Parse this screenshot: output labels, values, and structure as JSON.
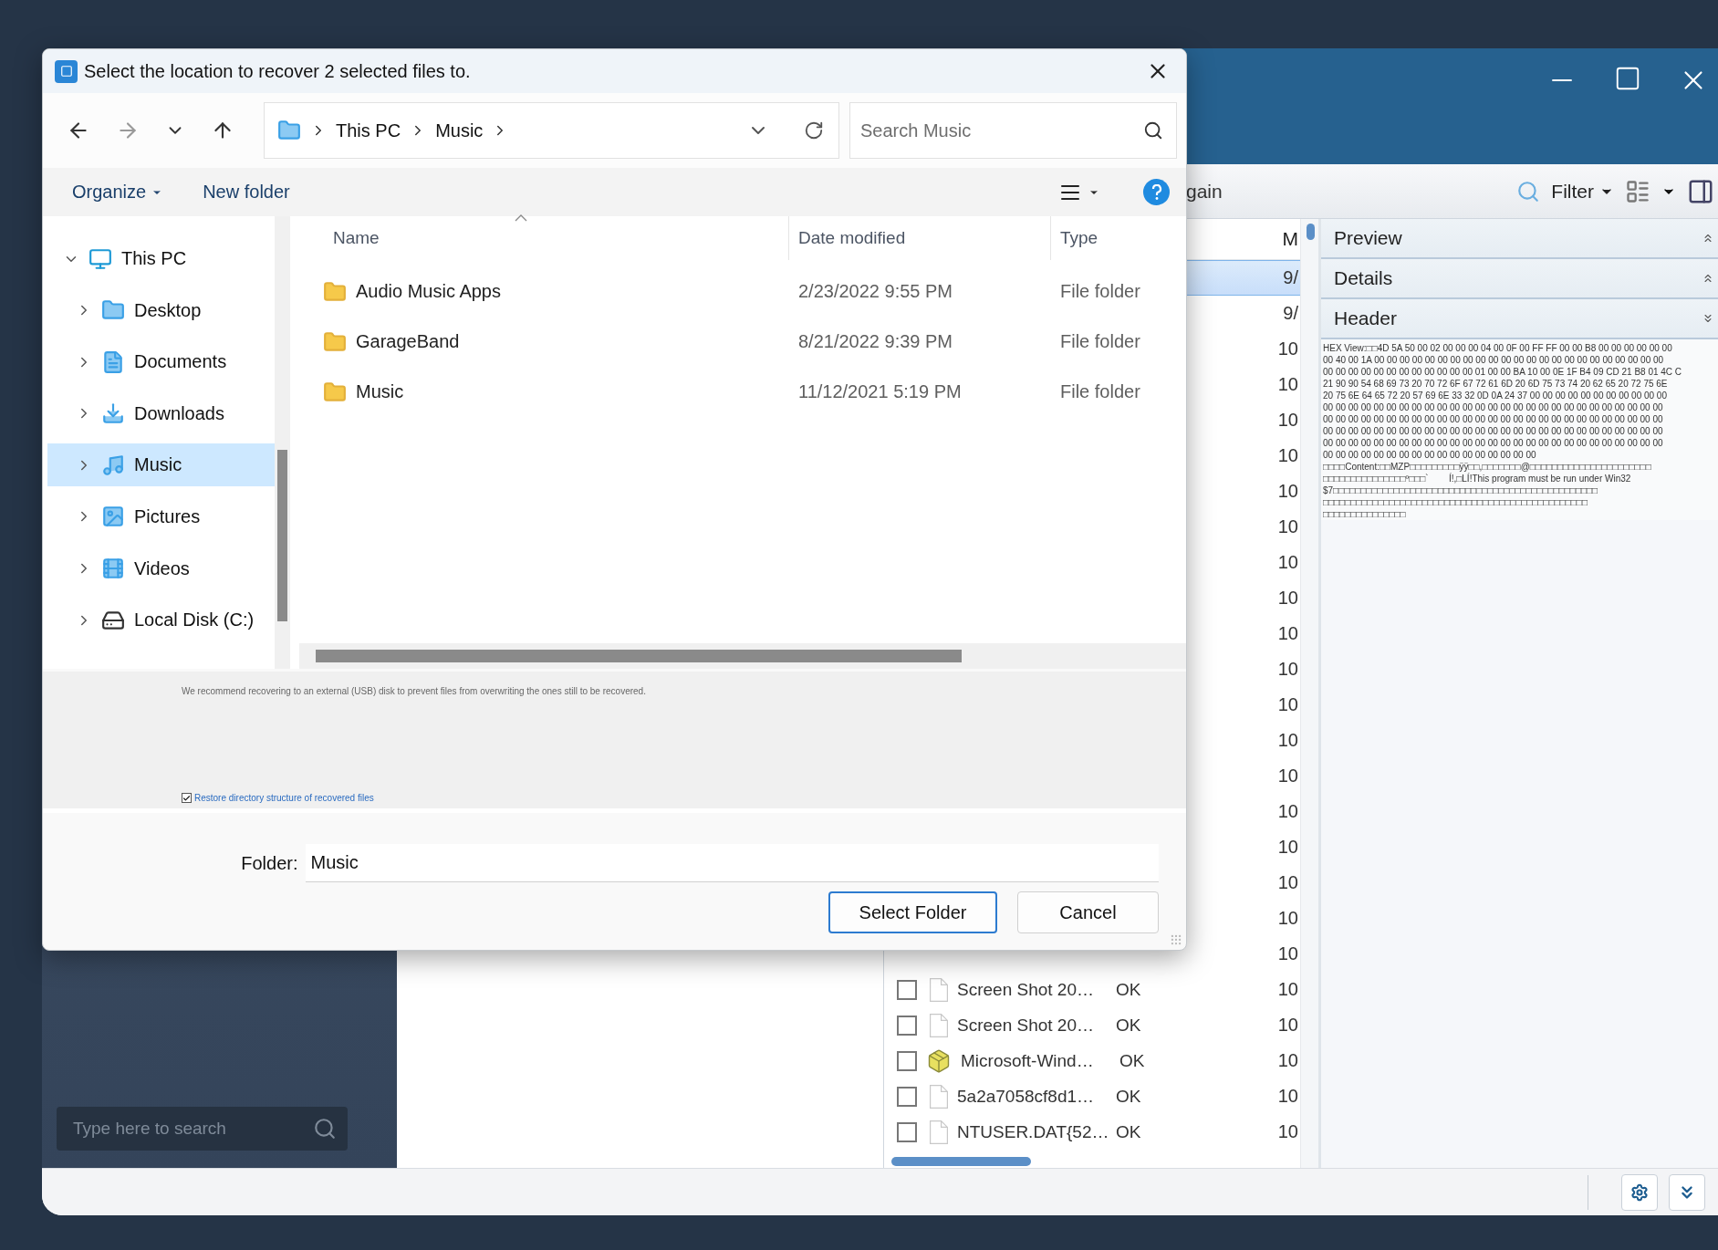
{
  "app": {
    "toolbar": {
      "partial_label": "gain",
      "filter": "Filter"
    },
    "sidebar": {
      "search": {
        "placeholder": "Type here to search"
      }
    },
    "file_list": {
      "column_header": "M",
      "rows": [
        {
          "selected": true,
          "date": "9/"
        },
        {
          "selected": false,
          "date": "9/"
        },
        {
          "selected": false,
          "date": "10"
        },
        {
          "selected": false,
          "date": "10"
        },
        {
          "selected": false,
          "date": "10"
        },
        {
          "selected": false,
          "date": "10"
        },
        {
          "selected": false,
          "date": "10"
        },
        {
          "selected": false,
          "date": "10"
        },
        {
          "selected": false,
          "date": "10"
        },
        {
          "selected": false,
          "date": "10"
        },
        {
          "selected": false,
          "date": "10"
        },
        {
          "selected": false,
          "date": "10"
        },
        {
          "selected": false,
          "date": "10"
        },
        {
          "selected": false,
          "date": "10"
        },
        {
          "selected": false,
          "date": "10"
        },
        {
          "selected": false,
          "date": "10"
        },
        {
          "selected": false,
          "date": "10"
        },
        {
          "selected": false,
          "date": "10"
        },
        {
          "selected": false,
          "date": "10"
        },
        {
          "selected": false,
          "date": "10"
        },
        {
          "selected": false,
          "date": "10",
          "checked": false,
          "kind": "file",
          "name": "Screen Shot 20…",
          "status": "OK"
        },
        {
          "selected": false,
          "date": "10",
          "checked": false,
          "kind": "file",
          "name": "Screen Shot 20…",
          "status": "OK"
        },
        {
          "selected": false,
          "date": "10",
          "checked": false,
          "kind": "package",
          "name": "Microsoft-Wind…",
          "status": "OK"
        },
        {
          "selected": false,
          "date": "10",
          "checked": false,
          "kind": "file",
          "name": "5a2a7058cf8d1…",
          "status": "OK"
        },
        {
          "selected": false,
          "date": "10",
          "checked": false,
          "kind": "file",
          "name": "NTUSER.DAT{52…",
          "status": "OK"
        }
      ]
    },
    "side_panel": {
      "sections": [
        {
          "title": "Preview",
          "expanded": false
        },
        {
          "title": "Details",
          "expanded": false
        },
        {
          "title": "Header",
          "expanded": true
        }
      ],
      "hex_lines": [
        "HEX View:□□4D 5A 50 00 02 00 00 00 04 00 0F 00 FF FF 00 00 B8 00 00 00 00 00 00",
        "00 40 00 1A 00 00 00 00 00 00 00 00 00 00 00 00 00 00 00 00 00 00 00 00 00 00 00",
        "00 00 00 00 00 00 00 00 00 00 00 00 01 00 00 BA 10 00 0E 1F B4 09 CD 21 B8 01 4C C",
        "21 90 90 54 68 69 73 20 70 72 6F 67 72 61 6D 20 6D 75 73 74 20 62 65 20 72 75 6E",
        "20 75 6E 64 65 72 20 57 69 6E 33 32 0D 0A 24 37 00 00 00 00 00 00 00 00 00 00 00",
        "00 00 00 00 00 00 00 00 00 00 00 00 00 00 00 00 00 00 00 00 00 00 00 00 00 00 00",
        "00 00 00 00 00 00 00 00 00 00 00 00 00 00 00 00 00 00 00 00 00 00 00 00 00 00 00",
        "00 00 00 00 00 00 00 00 00 00 00 00 00 00 00 00 00 00 00 00 00 00 00 00 00 00 00",
        "00 00 00 00 00 00 00 00 00 00 00 00 00 00 00 00 00 00 00 00 00 00 00 00 00 00 00",
        "00 00 00 00 00 00 00 00 00 00 00 00 00 00 00 00 00",
        "□□□□Content:□□MZP□□□□□□□□□ÿÿ□□,□□□□□□□@□□□□□□□□□□□□□□□□□□□□□□",
        "□□□□□□□□□□□□□□□º□□□`        Í!,□LÍ!This program must be run under Win32",
        "$7□□□□□□□□□□□□□□□□□□□□□□□□□□□□□□□□□□□□□□□□□□□□□□□□",
        "□□□□□□□□□□□□□□□□□□□□□□□□□□□□□□□□□□□□□□□□□□□□□□□□",
        "□□□□□□□□□□□□□□□"
      ]
    }
  },
  "dialog": {
    "title": "Select the location to recover 2 selected files to.",
    "breadcrumb": [
      "This PC",
      "Music"
    ],
    "search": {
      "placeholder": "Search Music"
    },
    "commands": {
      "organize": "Organize",
      "new_folder": "New folder"
    },
    "nav_tree": [
      {
        "label": "This PC",
        "kind": "pc",
        "expanded": true,
        "selected": false,
        "children": [
          {
            "label": "Desktop",
            "kind": "desktop",
            "expanded": false,
            "selected": false
          },
          {
            "label": "Documents",
            "kind": "documents",
            "expanded": false,
            "selected": false
          },
          {
            "label": "Downloads",
            "kind": "downloads",
            "expanded": false,
            "selected": false
          },
          {
            "label": "Music",
            "kind": "music",
            "expanded": false,
            "selected": true
          },
          {
            "label": "Pictures",
            "kind": "pictures",
            "expanded": false,
            "selected": false
          },
          {
            "label": "Videos",
            "kind": "videos",
            "expanded": false,
            "selected": false
          },
          {
            "label": "Local Disk (C:)",
            "kind": "disk",
            "expanded": false,
            "selected": false
          }
        ]
      }
    ],
    "columns": [
      "Name",
      "Date modified",
      "Type"
    ],
    "rows": [
      {
        "name": "Audio Music Apps",
        "date": "2/23/2022 9:55 PM",
        "type": "File folder"
      },
      {
        "name": "GarageBand",
        "date": "8/21/2022 9:39 PM",
        "type": "File folder"
      },
      {
        "name": "Music",
        "date": "11/12/2021 5:19 PM",
        "type": "File folder"
      }
    ],
    "notice": "We recommend recovering to an external (USB) disk to prevent files from overwriting the ones still to be recovered.",
    "restore_option": {
      "label": "Restore directory structure of recovered files",
      "checked": true
    },
    "folder": {
      "label": "Folder:",
      "value": "Music"
    },
    "buttons": {
      "primary": "Select Folder",
      "secondary": "Cancel"
    }
  }
}
